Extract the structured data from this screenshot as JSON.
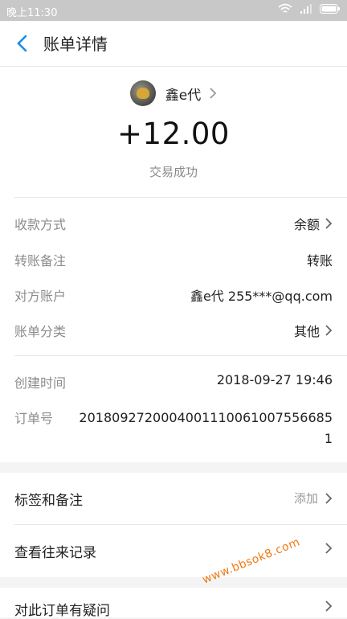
{
  "status_bar": {
    "time": "晚上11:30"
  },
  "header": {
    "title": "账单详情"
  },
  "payee": {
    "name": "鑫e代"
  },
  "transaction": {
    "amount": "+12.00",
    "status": "交易成功"
  },
  "details": [
    {
      "label": "收款方式",
      "value": "余额"
    },
    {
      "label": "转账备注",
      "value": "转账"
    },
    {
      "label": "对方账户",
      "value": "鑫e代 255***@qq.com"
    },
    {
      "label": "账单分类",
      "value": "其他"
    }
  ],
  "meta": {
    "created_label": "创建时间",
    "created_value": "2018-09-27 19:46",
    "order_label": "订单号",
    "order_value": "2018092720004001110061007556685 1"
  },
  "actions": {
    "tags_label": "标签和备注",
    "tags_action": "添加",
    "history_label": "查看往来记录",
    "question_label": "对此订单有疑问"
  },
  "watermark": "www.bbsok8.com"
}
